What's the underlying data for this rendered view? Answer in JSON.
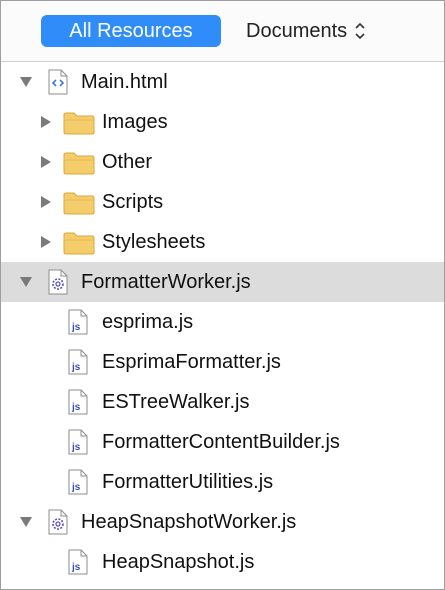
{
  "header": {
    "all_resources": "All Resources",
    "documents": "Documents"
  },
  "tree": [
    {
      "label": "Main.html",
      "type": "html-file",
      "expanded": true,
      "level": 0
    },
    {
      "label": "Images",
      "type": "folder",
      "expanded": false,
      "level": 1
    },
    {
      "label": "Other",
      "type": "folder",
      "expanded": false,
      "level": 1
    },
    {
      "label": "Scripts",
      "type": "folder",
      "expanded": false,
      "level": 1
    },
    {
      "label": "Stylesheets",
      "type": "folder",
      "expanded": false,
      "level": 1
    },
    {
      "label": "FormatterWorker.js",
      "type": "worker",
      "expanded": true,
      "selected": true,
      "level": 0
    },
    {
      "label": "esprima.js",
      "type": "js-file",
      "level": 1
    },
    {
      "label": "EsprimaFormatter.js",
      "type": "js-file",
      "level": 1
    },
    {
      "label": "ESTreeWalker.js",
      "type": "js-file",
      "level": 1
    },
    {
      "label": "FormatterContentBuilder.js",
      "type": "js-file",
      "level": 1
    },
    {
      "label": "FormatterUtilities.js",
      "type": "js-file",
      "level": 1
    },
    {
      "label": "HeapSnapshotWorker.js",
      "type": "worker",
      "expanded": true,
      "level": 0
    },
    {
      "label": "HeapSnapshot.js",
      "type": "js-file",
      "level": 1
    }
  ],
  "colors": {
    "accent": "#2f8cf8",
    "selected_row": "#dcdcdc",
    "folder": "#f3cd6b",
    "js_icon_text": "#3b4fb6"
  }
}
